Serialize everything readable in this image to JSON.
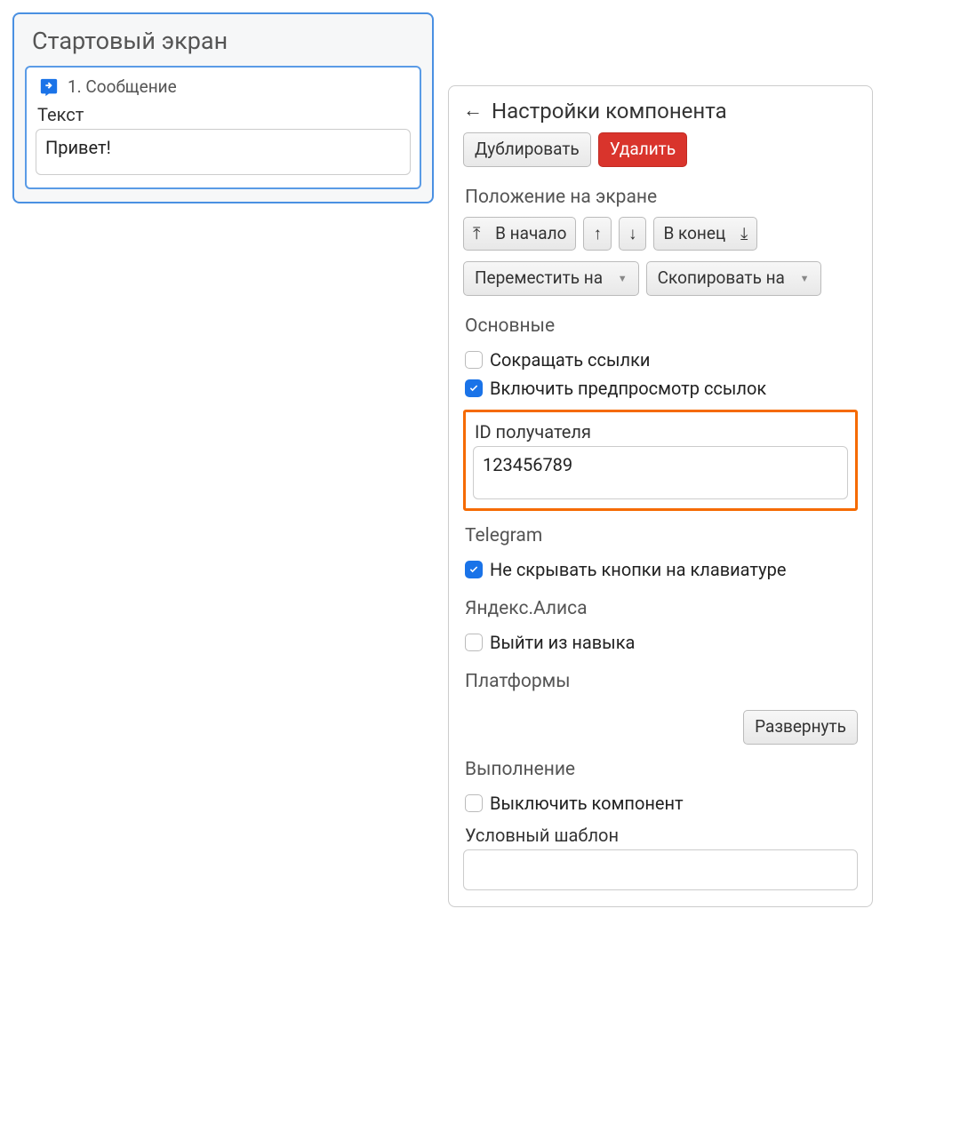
{
  "left": {
    "screen_title": "Стартовый экран",
    "component": {
      "label": "1. Сообщение",
      "text_label": "Текст",
      "text_value": "Привет!"
    }
  },
  "settings": {
    "title": "Настройки компонента",
    "duplicate": "Дублировать",
    "delete": "Удалить",
    "position_heading": "Положение на экране",
    "to_start": "В начало",
    "to_end": "В конец",
    "move_to": "Переместить на",
    "copy_to": "Скопировать на",
    "main_heading": "Основные",
    "shorten_links": "Сокращать ссылки",
    "enable_preview": "Включить предпросмотр ссылок",
    "recipient_id_label": "ID получателя",
    "recipient_id_value": "123456789",
    "telegram_heading": "Telegram",
    "telegram_show_buttons": "Не скрывать кнопки на клавиатуре",
    "alice_heading": "Яндекс.Алиса",
    "alice_exit": "Выйти из навыка",
    "platforms_heading": "Платформы",
    "expand": "Развернуть",
    "execution_heading": "Выполнение",
    "disable_component": "Выключить компонент",
    "template_label": "Условный шаблон"
  },
  "checked": {
    "shorten_links": false,
    "enable_preview": true,
    "telegram_show_buttons": true,
    "alice_exit": false,
    "disable_component": false
  }
}
